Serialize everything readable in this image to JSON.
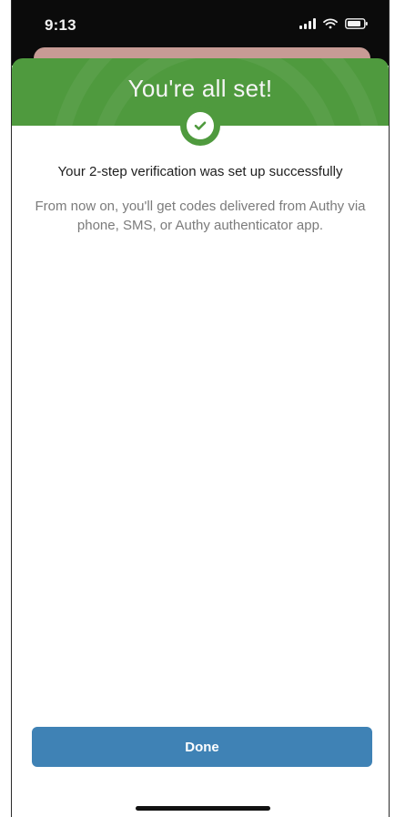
{
  "status_bar": {
    "time": "9:13",
    "icons": [
      "signal-icon",
      "wifi-icon",
      "battery-icon"
    ]
  },
  "modal": {
    "title": "You're all set!",
    "badge_icon": "check-circle-icon",
    "heading": "Your 2-step verification was set up successfully",
    "description": "From now on, you'll get codes delivered from Authy via phone, SMS, or Authy authenticator app.",
    "done_label": "Done"
  },
  "colors": {
    "header_green": "#4f9a3e",
    "button_blue": "#3f82b5",
    "background_sheet_pink": "#c79b95",
    "status_bar": "#0b0b0b"
  }
}
